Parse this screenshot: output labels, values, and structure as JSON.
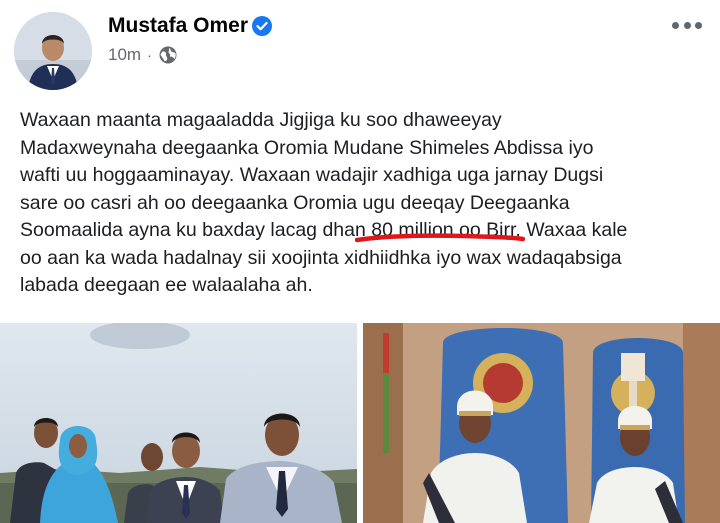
{
  "post": {
    "author": "Mustafa Omer",
    "time": "10m",
    "separator": "·",
    "lines": [
      "Waxaan maanta magaaladda Jigjiga ku soo dhaweeyay",
      "Madaxweynaha deegaanka Oromia Mudane Shimeles Abdissa iyo",
      "wafti uu hoggaaminayay. Waxaan wadajir xadhiga uga jarnay Dugsi",
      "sare oo casri ah oo deegaanka Oromia ugu deeqay Deegaanka"
    ],
    "line5_before": "Soomaalida ayna ku baxday lacag dha",
    "line5_highlight": "n 80 million oo Bi",
    "line5_after": "rr. Waxaa kale",
    "line6": "oo aan ka wada hadalnay sii xoojinta xidhiidhka iyo wax wadaqabsiga",
    "line7": "labada deegaan ee walaalaha ah."
  },
  "colors": {
    "verified": "#1877f2",
    "meta_gray": "#65676b",
    "underline": "#e0161b"
  },
  "icons": {
    "verified": "verified-badge-icon",
    "privacy": "globe-icon",
    "menu": "more-options-icon"
  }
}
